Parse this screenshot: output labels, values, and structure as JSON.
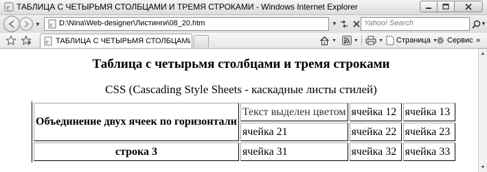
{
  "window": {
    "title": "ТАБЛИЦА С ЧЕТЫРЬМЯ СТОЛБЦАМИ И ТРЕМЯ СТРОКАМИ - Windows Internet Explorer"
  },
  "address_bar": {
    "url": "D:\\Nina\\Web-designer\\Листинги\\08_20.htm",
    "search_placeholder": "Yahoo! Search"
  },
  "tab": {
    "label": "ТАБЛИЦА С ЧЕТЫРЬМЯ СТОЛБЦАМИ И ТРЕМ..."
  },
  "commands": {
    "page_label": "Страница",
    "tools_label": "Сервис"
  },
  "page": {
    "heading": "Таблица с четырьмя столбцами и тремя строками",
    "subtitle": "CSS (Cascading Style Sheets - каскадные листы стилей)",
    "table": {
      "merged_cell": "Объединение двух ячеек по горизонтали",
      "row1": [
        "Текст выделен цветом",
        "ячейка 12",
        "ячейка 13"
      ],
      "row2": [
        "ячейка 21",
        "ячейка 22",
        "ячейка 23"
      ],
      "row3_label": "строка 3",
      "row3": [
        "ячейка 31",
        "ячейка 32",
        "ячейка 33"
      ]
    }
  },
  "icons": {
    "app": "ie-icon",
    "back": "back-arrow-icon",
    "forward": "forward-arrow-icon",
    "refresh": "refresh-icon",
    "stop": "stop-icon",
    "search": "search-icon",
    "favorites": "favorites-star-icon",
    "add_favorites": "add-favorites-icon",
    "home": "home-icon",
    "feeds": "feeds-icon",
    "print": "print-icon",
    "page": "page-icon",
    "tools": "gear-icon"
  },
  "colors": {
    "highlighted_text": "#333333"
  }
}
